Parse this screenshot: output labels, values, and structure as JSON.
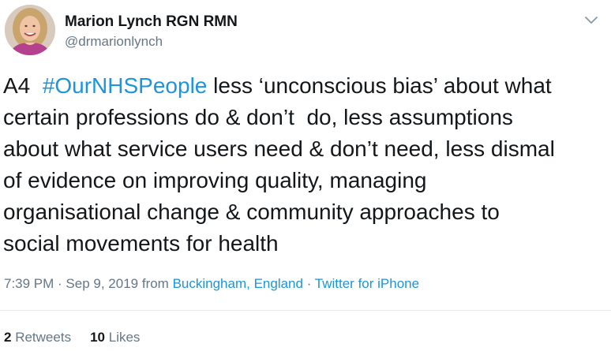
{
  "author": {
    "display_name": "Marion Lynch RGN RMN",
    "handle": "@drmarionlynch"
  },
  "tweet": {
    "prefix": "A4  ",
    "hashtag": "#OurNHSPeople",
    "lines": [
      " less ‘unconscious bias’ about what",
      "certain professions do & don’t  do, less assumptions",
      "about what service users need & don’t need, less dismal",
      "of evidence on improving quality, managing",
      "organisational change & community approaches to",
      "social movements for health"
    ]
  },
  "meta": {
    "time": "7:39 PM",
    "sep1": " · ",
    "date": "Sep 9, 2019",
    "from_label": " from ",
    "location": "Buckingham, England",
    "sep2": " · ",
    "source": "Twitter for iPhone"
  },
  "stats": {
    "retweets_count": "2",
    "retweets_label": "Retweets",
    "likes_count": "10",
    "likes_label": "Likes"
  },
  "icons": {
    "menu": "chevron-down-icon",
    "avatar": "user-photo"
  },
  "colors": {
    "link": "#1b95e0",
    "secondary_text": "#657786",
    "primary_text": "#14171a",
    "divider": "#e6ecf0"
  }
}
